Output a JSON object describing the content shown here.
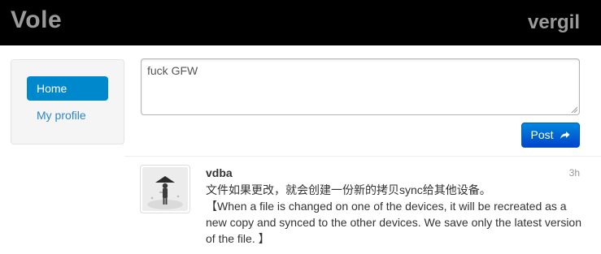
{
  "header": {
    "brand": "Vole",
    "username": "vergil"
  },
  "sidebar": {
    "items": [
      {
        "label": "Home",
        "active": true
      },
      {
        "label": "My profile",
        "active": false
      }
    ]
  },
  "composer": {
    "value": "fuck GFW",
    "post_label": "Post",
    "post_icon": "share-arrow-icon"
  },
  "feed": {
    "items": [
      {
        "author": "vdba",
        "time": "3h",
        "avatar_icon": "user-avatar-icon",
        "text_zh": "文件如果更改，就会创建一份新的拷贝sync给其他设备。",
        "text_en": "【When a file is changed on one of the devices, it will be recreated as a new copy and synced to the other devices. We save only the latest version of the file. 】"
      }
    ]
  },
  "colors": {
    "topbar": "#000000",
    "accent": "#0088cc",
    "link": "#2a86c8"
  }
}
